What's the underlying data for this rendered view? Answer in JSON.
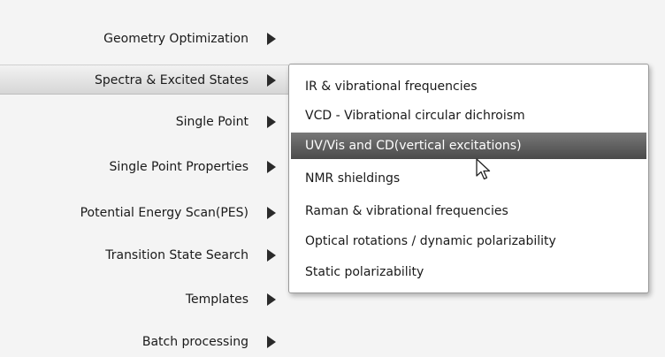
{
  "left_menu": {
    "items": [
      {
        "label": "Geometry Optimization"
      },
      {
        "label": "Spectra & Excited States"
      },
      {
        "label": "Single Point"
      },
      {
        "label": "Single Point Properties"
      },
      {
        "label": "Potential Energy Scan(PES)"
      },
      {
        "label": "Transition State Search"
      },
      {
        "label": "Templates"
      },
      {
        "label": "Batch processing"
      }
    ],
    "active_item": "Spectra & Excited States"
  },
  "submenu": {
    "items": [
      {
        "label": "IR & vibrational frequencies"
      },
      {
        "label": "VCD - Vibrational circular dichroism"
      },
      {
        "label": "UV/Vis and CD(vertical excitations)"
      },
      {
        "label": "NMR shieldings"
      },
      {
        "label": "Raman & vibrational frequencies"
      },
      {
        "label": "Optical rotations / dynamic polarizability"
      },
      {
        "label": "Static polarizability"
      }
    ],
    "selected_item": "UV/Vis and CD(vertical excitations)"
  },
  "icons": {
    "submenu_arrow": "triangle-right-icon",
    "cursor": "mouse-pointer-icon"
  },
  "colors": {
    "background": "#f4f4f4",
    "selected_bg": "#5a5a5a",
    "selected_text": "#ffffff"
  }
}
